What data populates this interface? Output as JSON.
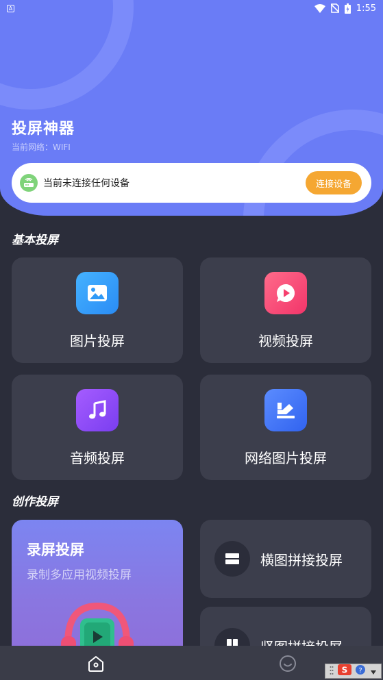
{
  "status_bar": {
    "time": "1:55",
    "notification_badge": "A",
    "icons": [
      "wifi-icon",
      "no-sim-icon",
      "battery-icon"
    ]
  },
  "header": {
    "title": "投屏神器",
    "network_label": "当前网络：WIFI"
  },
  "connection": {
    "status_text": "当前未连接任何设备",
    "button_label": "连接设备",
    "icon": "router-icon"
  },
  "basic_section": {
    "title": "基本投屏",
    "items": [
      {
        "label": "图片投屏",
        "icon": "image-icon",
        "color": "#2f9af7"
      },
      {
        "label": "视频投屏",
        "icon": "video-icon",
        "color": "#f6406e"
      },
      {
        "label": "音频投屏",
        "icon": "music-icon",
        "color": "#8a4af3"
      },
      {
        "label": "网络图片投屏",
        "icon": "web-image-icon",
        "color": "#3f75f5"
      }
    ]
  },
  "creative_section": {
    "title": "创作投屏",
    "record": {
      "title": "录屏投屏",
      "subtitle": "录制多应用视频投屏"
    },
    "items": [
      {
        "label": "横图拼接投屏",
        "icon": "horizontal-split-icon"
      },
      {
        "label": "竖图拼接投屏",
        "icon": "vertical-split-icon"
      }
    ]
  },
  "bottom_nav": {
    "items": [
      {
        "name": "home",
        "icon": "home-icon"
      },
      {
        "name": "profile",
        "icon": "smiley-icon"
      }
    ]
  },
  "colors": {
    "accent": "#6a7cf6",
    "background": "#2b2d3a",
    "card": "#3c3e4c",
    "connect_button": "#f5a732"
  }
}
